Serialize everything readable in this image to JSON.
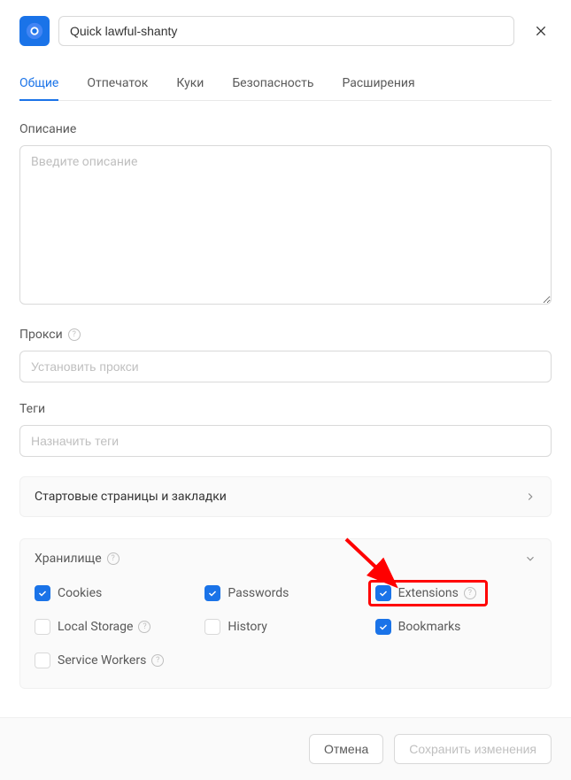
{
  "title_value": "Quick lawful-shanty",
  "tabs": [
    {
      "label": "Общие",
      "active": true
    },
    {
      "label": "Отпечаток",
      "active": false
    },
    {
      "label": "Куки",
      "active": false
    },
    {
      "label": "Безопасность",
      "active": false
    },
    {
      "label": "Расширения",
      "active": false
    }
  ],
  "description": {
    "label": "Описание",
    "placeholder": "Введите описание"
  },
  "proxy": {
    "label": "Прокси",
    "placeholder": "Установить прокси"
  },
  "tags": {
    "label": "Теги",
    "placeholder": "Назначить теги"
  },
  "startpages": {
    "title": "Стартовые страницы и закладки"
  },
  "storage": {
    "title": "Хранилище",
    "items": [
      {
        "label": "Cookies",
        "checked": true,
        "help": false
      },
      {
        "label": "Passwords",
        "checked": true,
        "help": false
      },
      {
        "label": "Extensions",
        "checked": true,
        "help": true,
        "highlighted": true
      },
      {
        "label": "Local Storage",
        "checked": false,
        "help": true
      },
      {
        "label": "History",
        "checked": false,
        "help": false
      },
      {
        "label": "Bookmarks",
        "checked": true,
        "help": false
      },
      {
        "label": "Service Workers",
        "checked": false,
        "help": true
      }
    ]
  },
  "footer": {
    "cancel": "Отмена",
    "save": "Сохранить изменения"
  }
}
